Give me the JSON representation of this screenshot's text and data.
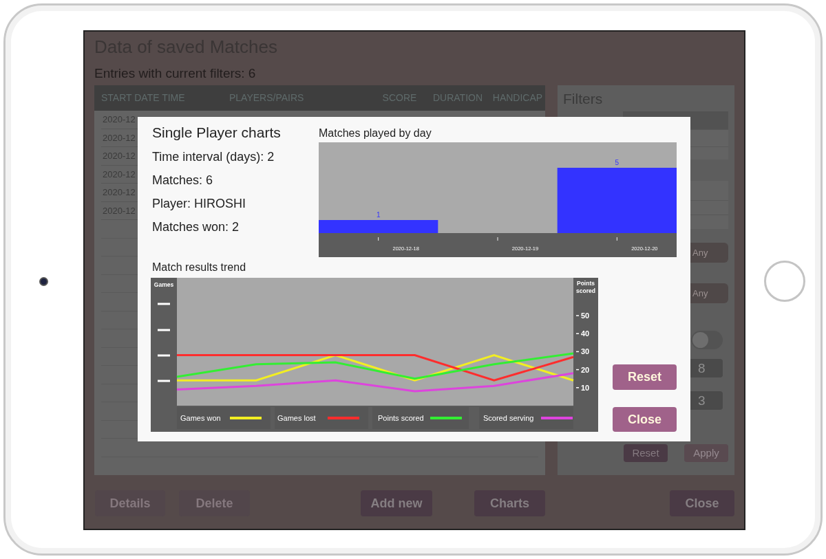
{
  "background": {
    "title": "Data of saved Matches",
    "subtitle": "Entries with current filters: 6",
    "table": {
      "columns": [
        "START DATE TIME",
        "PLAYERS/PAIRS",
        "SCORE",
        "DURATION",
        "HANDICAP"
      ],
      "rows": [
        [
          "2020-12"
        ],
        [
          "2020-12"
        ],
        [
          "2020-12"
        ],
        [
          "2020-12"
        ],
        [
          "2020-12"
        ],
        [
          "2020-12"
        ]
      ]
    },
    "filters": {
      "title": "Filters",
      "options": [
        "Any",
        "Any"
      ],
      "toggle": {
        "on": false
      },
      "fields": [
        "8",
        "3"
      ],
      "buttons": [
        {
          "label": "Reset",
          "disabled": false
        },
        {
          "label": "Apply",
          "disabled": true
        }
      ]
    },
    "buttons": [
      {
        "label": "Details",
        "disabled": true
      },
      {
        "label": "Delete",
        "disabled": true
      },
      {
        "label": "Add new",
        "disabled": false
      },
      {
        "label": "Charts",
        "disabled": false
      },
      {
        "label": "Close",
        "disabled": false
      }
    ]
  },
  "modal": {
    "title": "Single Player charts",
    "stats": [
      "Time interval (days): 2",
      "Matches: 6",
      "Player: HIROSHI",
      "Matches won: 2"
    ],
    "bar_chart": {
      "chart_data": {
        "type": "bar",
        "title": "Matches played by day",
        "categories": [
          "2020-12-18",
          "2020-12-19",
          "2020-12-20"
        ],
        "series": [
          {
            "color": "#3333ff",
            "values": [
              1,
              null,
              5
            ]
          }
        ],
        "data_labels": true
      }
    },
    "trend_chart": {
      "left_axis_label": "Games",
      "chart_data": {
        "type": "line",
        "title": "Match results trend",
        "ylabel": "Points scored",
        "ylim": [
          0,
          71
        ],
        "yticks": [
          50,
          40,
          30,
          20,
          10
        ],
        "legend": true,
        "series": [
          {
            "name": "Games won",
            "color": "#f2ee22",
            "values": [
              14,
              14,
              28,
              14,
              28,
              14
            ]
          },
          {
            "name": "Games lost",
            "color": "#ff2d2d",
            "values": [
              28,
              28,
              28,
              28,
              14,
              27
            ]
          },
          {
            "name": "Points scored",
            "color": "#33ee33",
            "values": [
              16,
              23,
              24,
              15,
              23,
              29
            ]
          },
          {
            "name": "Scored serving",
            "color": "#dd44dd",
            "values": [
              9,
              11,
              14,
              8,
              11,
              18
            ]
          }
        ]
      }
    },
    "buttons": [
      "Reset",
      "Close"
    ]
  }
}
